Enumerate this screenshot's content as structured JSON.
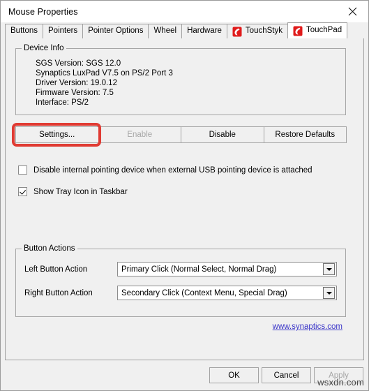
{
  "window": {
    "title": "Mouse Properties",
    "close_icon": "close-icon"
  },
  "tabs": [
    {
      "label": "Buttons",
      "icon": "",
      "active": false
    },
    {
      "label": "Pointers",
      "icon": "",
      "active": false
    },
    {
      "label": "Pointer Options",
      "icon": "",
      "active": false
    },
    {
      "label": "Wheel",
      "icon": "",
      "active": false
    },
    {
      "label": "Hardware",
      "icon": "",
      "active": false
    },
    {
      "label": "TouchStyk",
      "icon": "synaptics-logo-icon",
      "active": false
    },
    {
      "label": "TouchPad",
      "icon": "synaptics-logo-icon",
      "active": true
    }
  ],
  "device_info": {
    "group_title": "Device Info",
    "lines": [
      "SGS Version: SGS 12.0",
      "Synaptics LuxPad V7.5 on PS/2 Port 3",
      "Driver Version: 19.0.12",
      "Firmware Version: 7.5",
      "Interface: PS/2"
    ]
  },
  "action_buttons": [
    {
      "label": "Settings...",
      "disabled": false,
      "highlighted": true
    },
    {
      "label": "Enable",
      "disabled": true,
      "highlighted": false
    },
    {
      "label": "Disable",
      "disabled": false,
      "highlighted": false
    },
    {
      "label": "Restore Defaults",
      "disabled": false,
      "highlighted": false
    }
  ],
  "checkboxes": [
    {
      "label": "Disable internal pointing device when external USB pointing device is attached",
      "checked": false
    },
    {
      "label": "Show Tray Icon in Taskbar",
      "checked": true
    }
  ],
  "button_actions": {
    "group_title": "Button Actions",
    "rows": [
      {
        "label": "Left Button Action",
        "value": "Primary Click (Normal Select, Normal Drag)"
      },
      {
        "label": "Right Button Action",
        "value": "Secondary Click (Context Menu, Special Drag)"
      }
    ]
  },
  "link": {
    "label": "www.synaptics.com"
  },
  "footer": {
    "ok_label": "OK",
    "cancel_label": "Cancel",
    "apply_label": "Apply",
    "apply_disabled": true
  },
  "watermark": "wsxdn.com",
  "colors": {
    "highlight": "#e03b33",
    "link": "#3b36c8",
    "logo": "#e01b1b",
    "dialog_bg": "#f0f0f0"
  }
}
